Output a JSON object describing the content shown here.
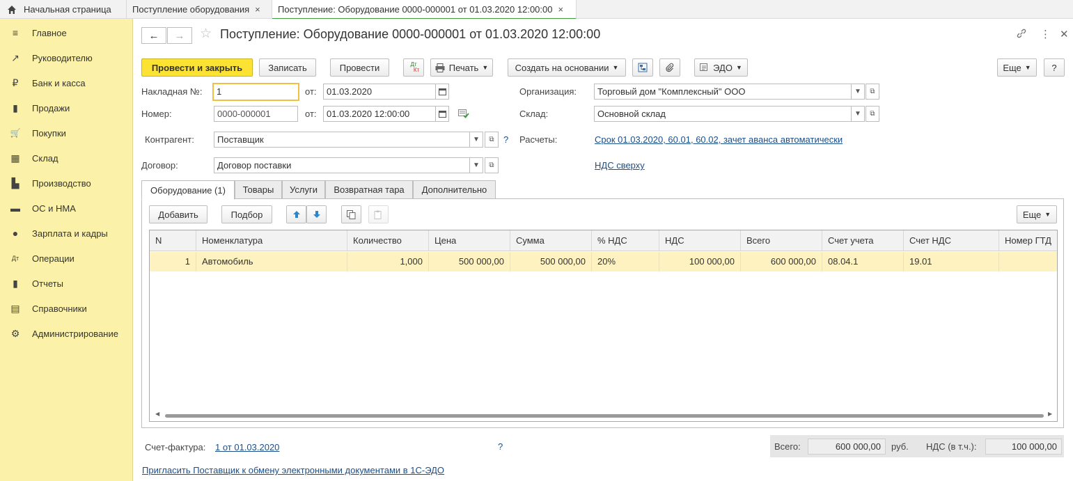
{
  "tabs": {
    "home": "Начальная страница",
    "tab1": "Поступление оборудования",
    "tab2": "Поступление: Оборудование 0000-000001 от 01.03.2020 12:00:00",
    "close": "×"
  },
  "sidebar": {
    "items": [
      {
        "label": "Главное",
        "icon": "≡"
      },
      {
        "label": "Руководителю",
        "icon": "↗"
      },
      {
        "label": "Банк и касса",
        "icon": "₽"
      },
      {
        "label": "Продажи",
        "icon": "▮"
      },
      {
        "label": "Покупки",
        "icon": "🛒"
      },
      {
        "label": "Склад",
        "icon": "▦"
      },
      {
        "label": "Производство",
        "icon": "▙"
      },
      {
        "label": "ОС и НМА",
        "icon": "▬"
      },
      {
        "label": "Зарплата и кадры",
        "icon": "●"
      },
      {
        "label": "Операции",
        "icon": "Дт"
      },
      {
        "label": "Отчеты",
        "icon": "▮"
      },
      {
        "label": "Справочники",
        "icon": "▤"
      },
      {
        "label": "Администрирование",
        "icon": "⚙"
      }
    ]
  },
  "header": {
    "title": "Поступление: Оборудование 0000-000001 от 01.03.2020 12:00:00",
    "back": "←",
    "forward": "→",
    "star": "☆",
    "link_icon": "🔗",
    "more_icon": "⋮",
    "close_icon": "✕"
  },
  "toolbar": {
    "post_close": "Провести и закрыть",
    "save": "Записать",
    "post": "Провести",
    "dtkt_top": "Дт",
    "dtkt_bottom": "Кт",
    "print": "Печать",
    "create_based": "Создать на основании",
    "edo": "ЭДО",
    "more": "Еще",
    "help": "?"
  },
  "form": {
    "invoice_label": "Накладная  №:",
    "invoice_value": "1",
    "from_label": "от:",
    "invoice_date": "01.03.2020",
    "number_label": "Номер:",
    "number_value": "0000-000001",
    "number_date": "01.03.2020 12:00:00",
    "org_label": "Организация:",
    "org_value": "Торговый дом \"Комплексный\" ООО",
    "warehouse_label": "Склад:",
    "warehouse_value": "Основной склад",
    "counterparty_label": "Контрагент:",
    "counterparty_value": "Поставщик",
    "q_mark": "?",
    "settlements_label": "Расчеты:",
    "settlements_link": "Срок 01.03.2020, 60.01, 60.02, зачет аванса автоматически",
    "contract_label": "Договор:",
    "contract_value": "Договор поставки",
    "vat_link": "НДС сверху"
  },
  "form_tabs": [
    "Оборудование (1)",
    "Товары",
    "Услуги",
    "Возвратная тара",
    "Дополнительно"
  ],
  "table_toolbar": {
    "add": "Добавить",
    "pick": "Подбор",
    "more": "Еще"
  },
  "table": {
    "headers": [
      "N",
      "Номенклатура",
      "Количество",
      "Цена",
      "Сумма",
      "% НДС",
      "НДС",
      "Всего",
      "Счет учета",
      "Счет НДС",
      "Номер ГТД"
    ],
    "rows": [
      [
        "1",
        "Автомобиль",
        "1,000",
        "500 000,00",
        "500 000,00",
        "20%",
        "100 000,00",
        "600 000,00",
        "08.04.1",
        "19.01",
        ""
      ]
    ]
  },
  "footer": {
    "invoice_label": "Счет-фактура:",
    "invoice_link": "1 от 01.03.2020",
    "q_mark": "?",
    "total_label": "Всего:",
    "total_value": "600 000,00",
    "currency": "руб.",
    "vat_label": "НДС (в т.ч.):",
    "vat_value": "100 000,00",
    "invite_link": "Пригласить Поставщик  к обмену электронными документами в 1С-ЭДО"
  }
}
